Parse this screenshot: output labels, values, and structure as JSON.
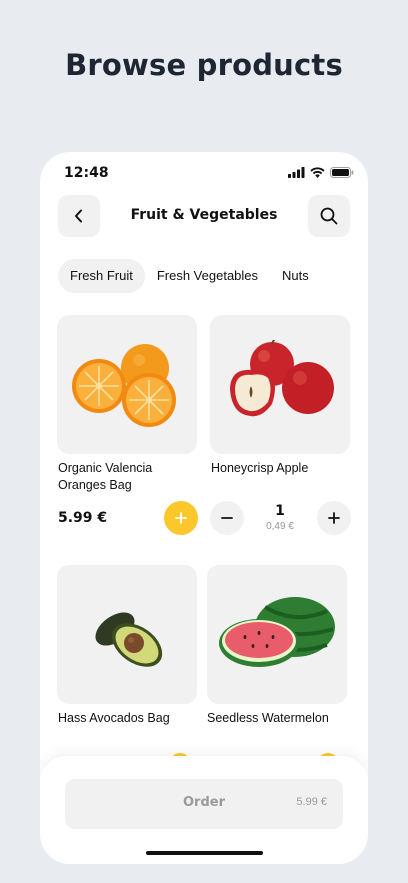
{
  "headline": "Browse products",
  "status_bar": {
    "time": "12:48",
    "icons": [
      "signal-icon",
      "wifi-icon",
      "battery-icon"
    ]
  },
  "nav": {
    "title": "Fruit & Vegetables",
    "back_icon": "chevron-left-icon",
    "search_icon": "search-icon"
  },
  "tabs": [
    {
      "label": "Fresh Fruit",
      "active": true
    },
    {
      "label": "Fresh Vegetables",
      "active": false
    },
    {
      "label": "Nuts",
      "active": false
    }
  ],
  "products": [
    {
      "name": "Organic Valencia Oranges Bag",
      "price": "5.99 €"
    },
    {
      "name": "Honeycrisp Apple",
      "quantity": "1",
      "unit_price": "0,49 €"
    },
    {
      "name": "Hass Avocados Bag"
    },
    {
      "name": "Seedless Watermelon"
    }
  ],
  "footer": {
    "order_label": "Order",
    "order_total": "5.99 €"
  },
  "colors": {
    "accent": "#fcc72a",
    "background": "#e8ebf0",
    "card": "#f1f1f1"
  }
}
